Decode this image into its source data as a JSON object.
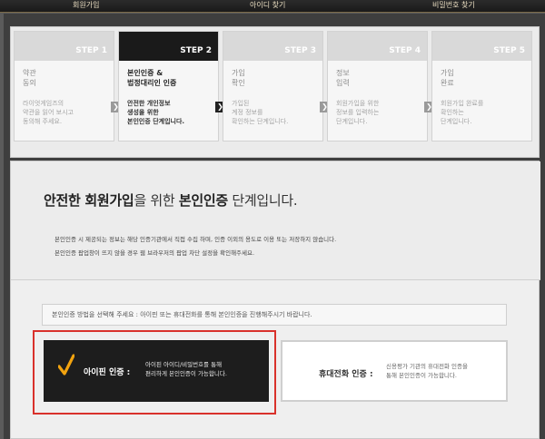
{
  "nav": [
    "회원가입",
    "아이디 찾기",
    "비밀번호 찾기"
  ],
  "steps": [
    {
      "label": "STEP 1",
      "name": "약관\n동의",
      "desc": "라이엇게임즈의\n약관을 읽어 보시고\n동의해 주세요."
    },
    {
      "label": "STEP 2",
      "name": "본인인증 &\n법정대리인 인증",
      "desc": "안전한 개인정보\n생성을 위한\n본인인증 단계입니다."
    },
    {
      "label": "STEP 3",
      "name": "가입\n확인",
      "desc": "가입된\n계정 정보를\n확인하는 단계입니다."
    },
    {
      "label": "STEP 4",
      "name": "정보\n입력",
      "desc": "회원가입을 위한\n정보를 입력하는\n단계입니다."
    },
    {
      "label": "STEP 5",
      "name": "가입\n완료",
      "desc": "회원가입 완료를\n확인하는\n단계입니다."
    }
  ],
  "main": {
    "title_b1": "안전한 회원가입",
    "title_t1": "을 위한 ",
    "title_b2": "본인인증",
    "title_t2": " 단계입니다.",
    "note1": "본인인증 시 제공되는 정보는 해당 인증기관에서 직접 수집 하며, 인증 이외의 용도로 이용 또는 저장하지 않습니다.",
    "note2": "본인인증 팝업창이 뜨지 않을 경우 웹 브라우저의 팝업 차단 설정을 확인해주세요.",
    "instruction": "본인인증 방법을 선택해 주세요 : 아이핀 또는 휴대전화를 통해 본인인증을 진행해주시기 바랍니다.",
    "ipin_label": "아이핀 인증 :",
    "ipin_desc": "아이핀 아이디/비밀번호를 통해\n편리하게 본인인증이 가능합니다.",
    "phone_label": "휴대전화 인증 :",
    "phone_desc": "신용평가 기관의 휴대전화 인증을\n통해 본인인증이 가능합니다."
  },
  "colors": {
    "accent_check": "#f2a30f",
    "highlight_border": "#d9312b",
    "active_step": "#1a1a1a"
  }
}
